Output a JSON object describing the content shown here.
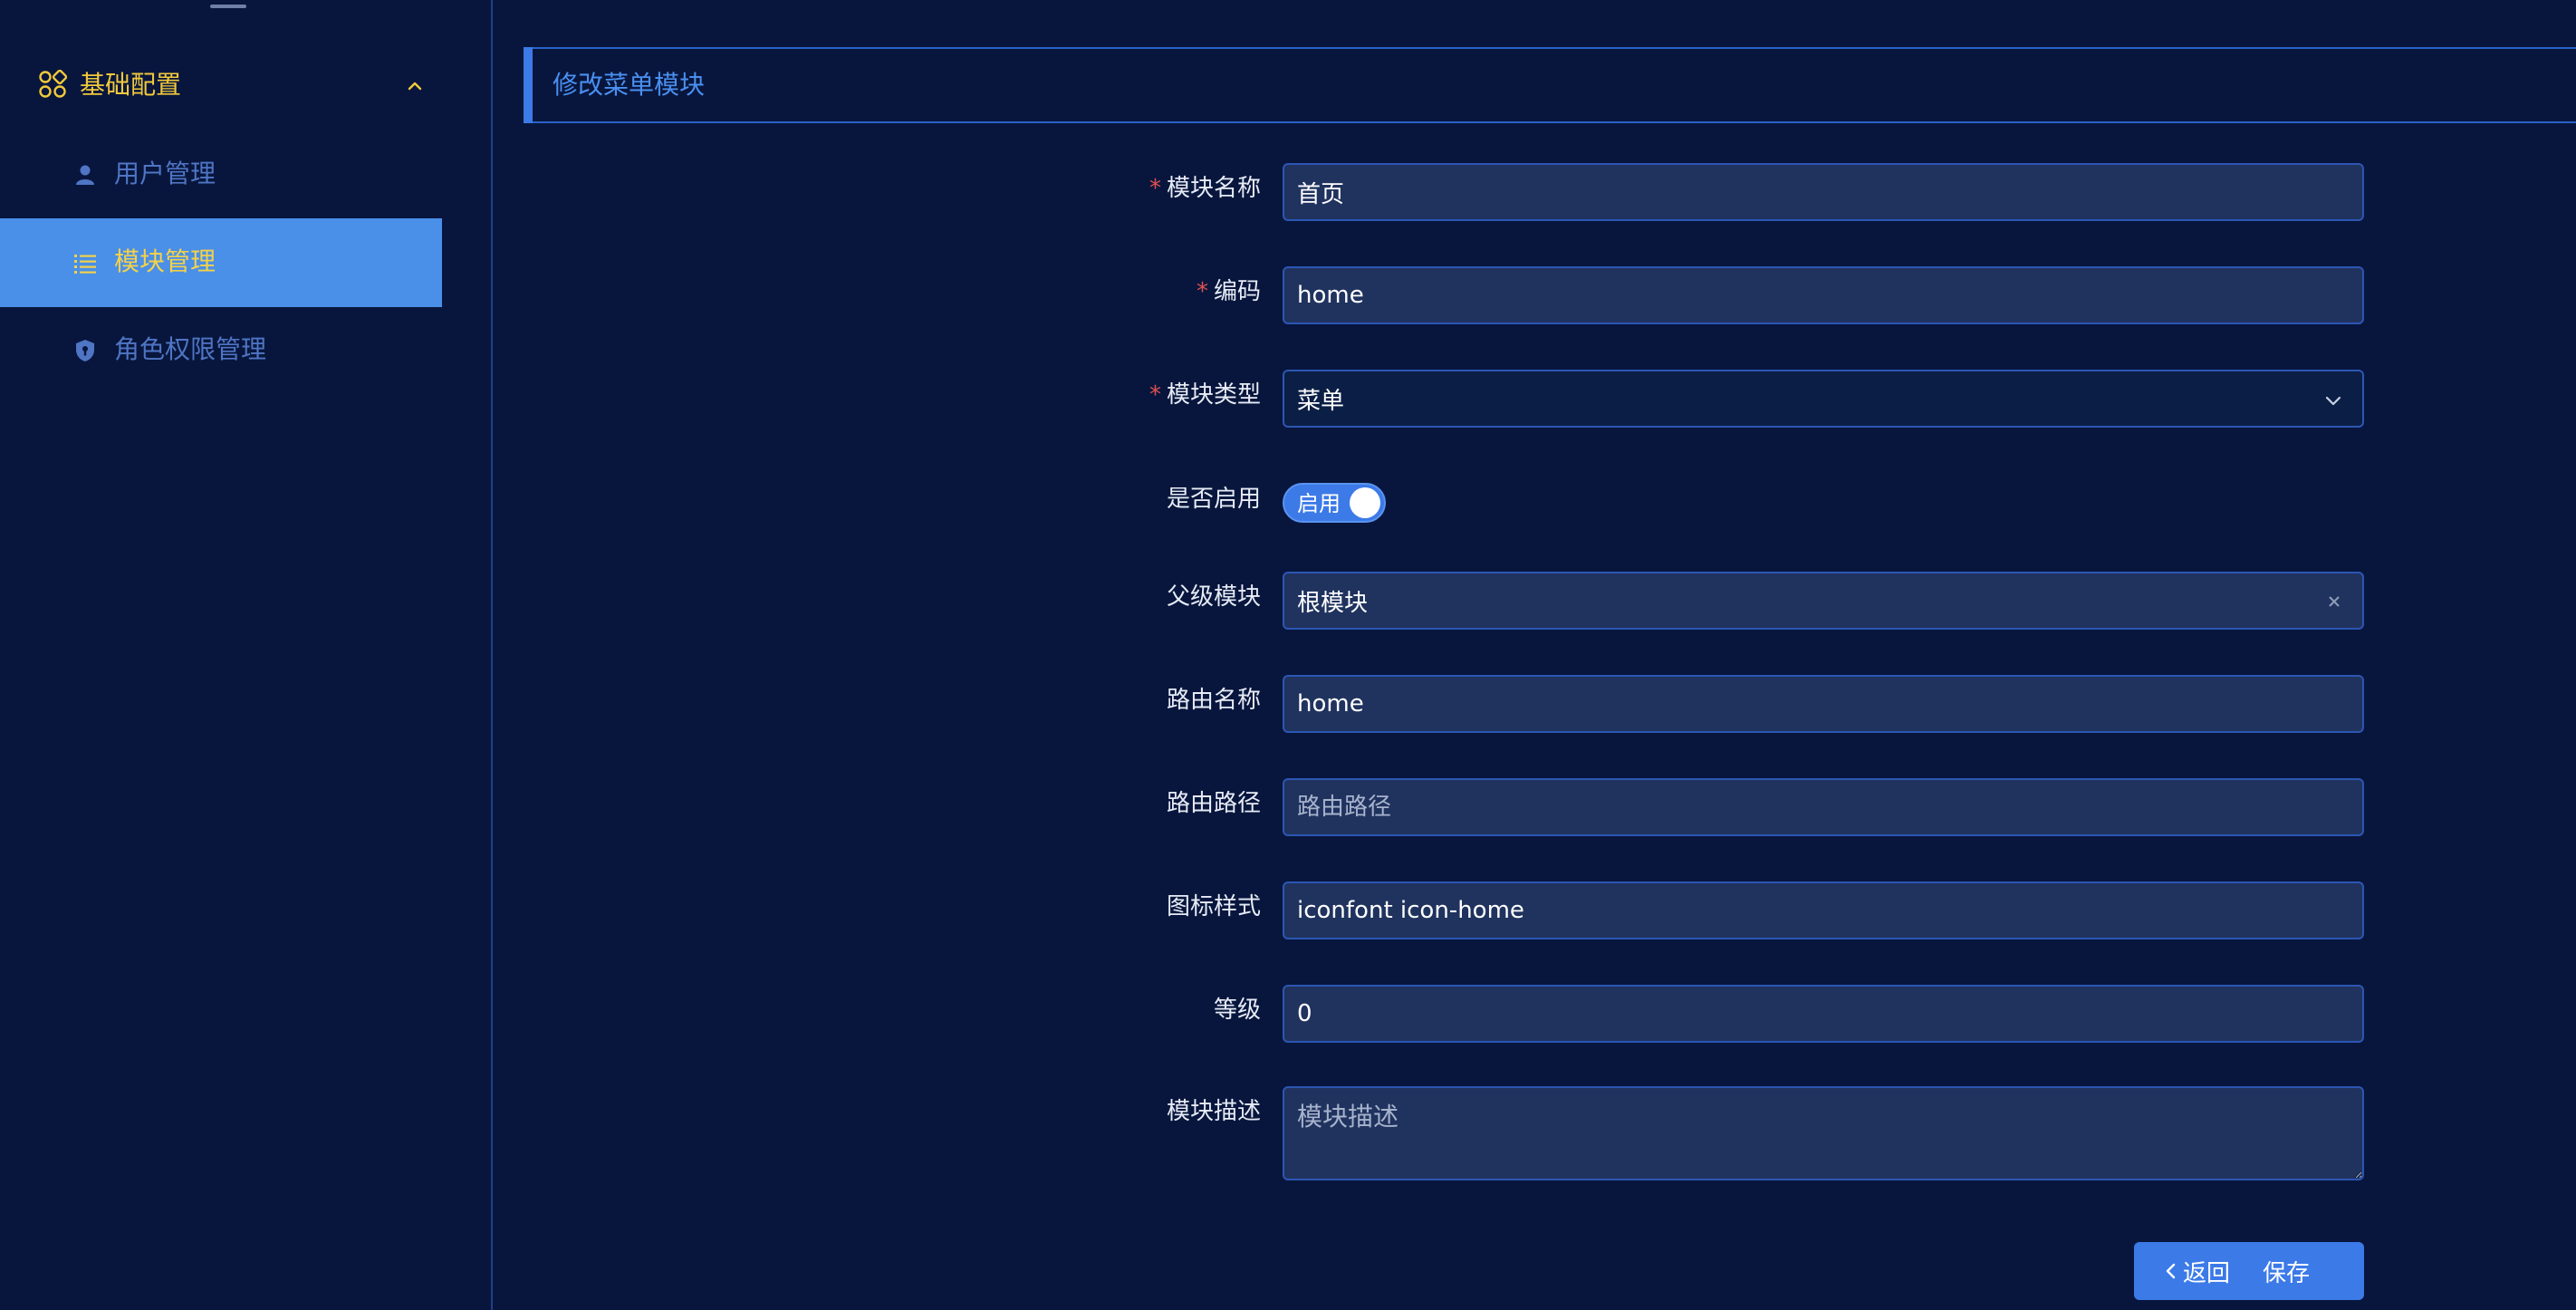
{
  "sidebar": {
    "group": {
      "label": "基础配置",
      "icon": "apps-icon",
      "expanded": true
    },
    "items": [
      {
        "label": "用户管理",
        "icon": "user-icon",
        "active": false
      },
      {
        "label": "模块管理",
        "icon": "list-icon",
        "active": true
      },
      {
        "label": "角色权限管理",
        "icon": "shield-icon",
        "active": false
      }
    ]
  },
  "header": {
    "title": "修改菜单模块"
  },
  "form": {
    "module_name": {
      "label": "模块名称",
      "required": true,
      "value": "首页"
    },
    "code": {
      "label": "编码",
      "required": true,
      "value": "home"
    },
    "module_type": {
      "label": "模块类型",
      "required": true,
      "value": "菜单"
    },
    "enabled": {
      "label": "是否启用",
      "switch_text": "启用",
      "on": true
    },
    "parent_module": {
      "label": "父级模块",
      "value": "根模块"
    },
    "route_name": {
      "label": "路由名称",
      "value": "home"
    },
    "route_path": {
      "label": "路由路径",
      "value": "",
      "placeholder": "路由路径"
    },
    "icon_style": {
      "label": "图标样式",
      "value": "iconfont icon-home"
    },
    "level": {
      "label": "等级",
      "value": "0"
    },
    "description": {
      "label": "模块描述",
      "value": "",
      "placeholder": "模块描述"
    }
  },
  "actions": {
    "back_label": "返回",
    "save_label": "保存"
  },
  "colors": {
    "background": "#08163d",
    "accent": "#3c7ae8",
    "active_menu": "#4a8fe8",
    "highlight_text": "#f1c93b",
    "input_bg": "#20335f",
    "required": "#e05050"
  }
}
